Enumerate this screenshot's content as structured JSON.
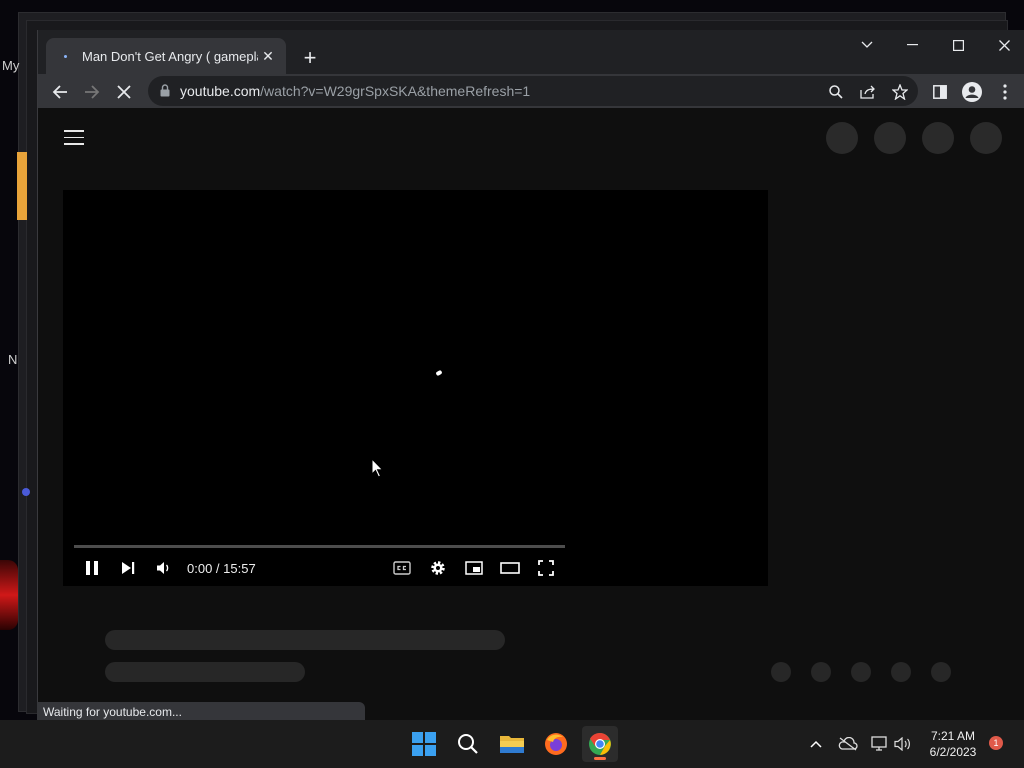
{
  "desktop": {
    "side_texts": [
      "My",
      "N"
    ]
  },
  "browser": {
    "tab": {
      "title": "Man Don't Get Angry ( gameplay",
      "close_glyph": "✕"
    },
    "new_tab_glyph": "+",
    "address": {
      "domain": "youtube.com",
      "path": "/watch?v=W29grSpxSKA&themeRefresh=1"
    },
    "status_text": "Waiting for youtube.com..."
  },
  "player": {
    "timecode": "0:00 / 15:57",
    "progress_fraction": 0
  },
  "taskbar": {
    "clock_time": "7:21 AM",
    "clock_date": "6/2/2023",
    "notification_count": "1"
  },
  "colors": {
    "page_background": "#0f0f0f",
    "skeleton": "#272727",
    "chrome_dark": "#202124",
    "chrome_toolbar": "#35363a",
    "accent_red": "#ff0000"
  }
}
